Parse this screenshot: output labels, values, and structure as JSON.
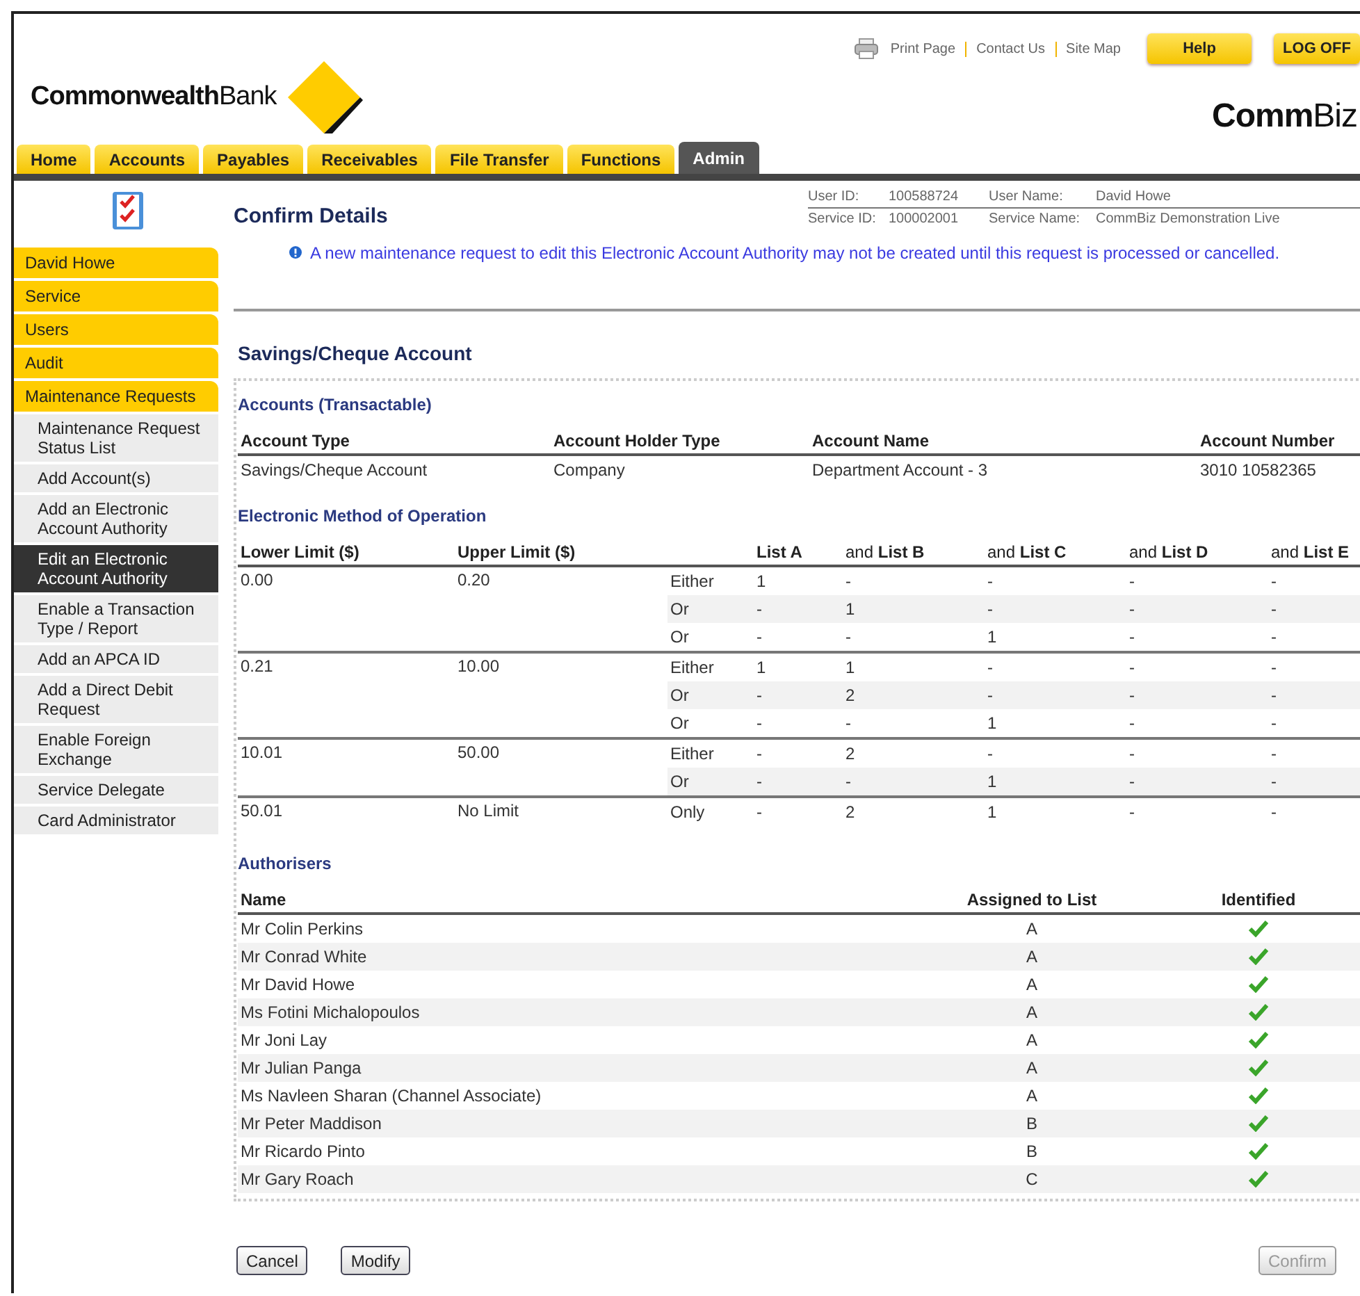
{
  "header": {
    "logo": "**Commonwealth**Bank",
    "links": [
      "Print Page",
      "Contact Us",
      "Site Map"
    ],
    "buttons": [
      "Help",
      "LOG OFF"
    ],
    "brand": "**Comm**Biz"
  },
  "tabs": [
    {
      "label": "Home",
      "selected": false
    },
    {
      "label": "Accounts",
      "selected": false
    },
    {
      "label": "Payables",
      "selected": false
    },
    {
      "label": "Receivables",
      "selected": false
    },
    {
      "label": "File Transfer",
      "selected": false
    },
    {
      "label": "Functions",
      "selected": false
    },
    {
      "label": "Admin",
      "selected": true
    }
  ],
  "sidebar": {
    "items": [
      {
        "label": "David Howe",
        "kind": "section",
        "selected": false
      },
      {
        "label": "Service",
        "kind": "section",
        "selected": false
      },
      {
        "label": "Users",
        "kind": "section",
        "selected": false
      },
      {
        "label": "Audit",
        "kind": "section",
        "selected": false
      },
      {
        "label": "Maintenance Requests",
        "kind": "section",
        "selected": false
      },
      {
        "label": "Maintenance Request Status List",
        "kind": "sub",
        "selected": false
      },
      {
        "label": "Add Account(s)",
        "kind": "sub",
        "selected": false
      },
      {
        "label": "Add an Electronic Account Authority",
        "kind": "sub",
        "selected": false
      },
      {
        "label": "Edit an Electronic Account Authority",
        "kind": "sub",
        "selected": true
      },
      {
        "label": "Enable a Transaction Type / Report",
        "kind": "sub",
        "selected": false
      },
      {
        "label": "Add an APCA ID",
        "kind": "sub",
        "selected": false
      },
      {
        "label": "Add a Direct Debit Request",
        "kind": "sub",
        "selected": false
      },
      {
        "label": "Enable Foreign Exchange",
        "kind": "sub",
        "selected": false
      },
      {
        "label": "Service Delegate",
        "kind": "sub",
        "selected": false
      },
      {
        "label": "Card Administrator",
        "kind": "sub",
        "selected": false
      }
    ]
  },
  "page_title": "Confirm Details",
  "user_info": [
    [
      {
        "label": "User ID:",
        "value": "100588724"
      },
      {
        "label": "User Name:",
        "value": "David Howe"
      }
    ],
    [
      {
        "label": "Service ID:",
        "value": "100002001"
      },
      {
        "label": "Service Name:",
        "value": "CommBiz Demonstration Live"
      }
    ]
  ],
  "notice": "A new maintenance request to edit this Electronic Account Authority may not be created until this request is processed or cancelled.",
  "account_heading": "Savings/Cheque Account",
  "accounts": {
    "title": "Accounts (Transactable)",
    "columns": [
      "Account Type",
      "Account Holder Type",
      "Account Name",
      "Account Number"
    ],
    "rows": [
      [
        "Savings/Cheque Account",
        "Company",
        "Department Account - 3",
        "3010 10582365"
      ]
    ]
  },
  "method": {
    "title": "Electronic Method of Operation",
    "columns": [
      "Lower Limit ($)",
      "Upper Limit ($)",
      "",
      "**List A**",
      "and **List B**",
      "and **List C**",
      "and **List D**",
      "and **List E**"
    ],
    "bands": [
      {
        "lower": "0.00",
        "upper": "0.20",
        "options": [
          [
            "Either",
            "1",
            "-",
            "-",
            "-",
            "-"
          ],
          [
            "Or",
            "-",
            "1",
            "-",
            "-",
            "-"
          ],
          [
            "Or",
            "-",
            "-",
            "1",
            "-",
            "-"
          ]
        ]
      },
      {
        "lower": "0.21",
        "upper": "10.00",
        "options": [
          [
            "Either",
            "1",
            "1",
            "-",
            "-",
            "-"
          ],
          [
            "Or",
            "-",
            "2",
            "-",
            "-",
            "-"
          ],
          [
            "Or",
            "-",
            "-",
            "1",
            "-",
            "-"
          ]
        ]
      },
      {
        "lower": "10.01",
        "upper": "50.00",
        "options": [
          [
            "Either",
            "-",
            "2",
            "-",
            "-",
            "-"
          ],
          [
            "Or",
            "-",
            "-",
            "1",
            "-",
            "-"
          ]
        ]
      },
      {
        "lower": "50.01",
        "upper": "No Limit",
        "options": [
          [
            "Only",
            "-",
            "2",
            "1",
            "-",
            "-"
          ]
        ]
      }
    ]
  },
  "authorisers": {
    "title": "Authorisers",
    "columns": [
      "Name",
      "Assigned to List",
      "Identified"
    ],
    "rows": [
      {
        "name": "Mr Colin Perkins",
        "list": "A",
        "identified": true
      },
      {
        "name": "Mr Conrad White",
        "list": "A",
        "identified": true
      },
      {
        "name": "Mr David Howe",
        "list": "A",
        "identified": true
      },
      {
        "name": "Ms Fotini Michalopoulos",
        "list": "A",
        "identified": true
      },
      {
        "name": "Mr Joni Lay",
        "list": "A",
        "identified": true
      },
      {
        "name": "Mr Julian Panga",
        "list": "A",
        "identified": true
      },
      {
        "name": "Ms Navleen Sharan (Channel Associate)",
        "list": "A",
        "identified": true
      },
      {
        "name": "Mr Peter Maddison",
        "list": "B",
        "identified": true
      },
      {
        "name": "Mr Ricardo Pinto",
        "list": "B",
        "identified": true
      },
      {
        "name": "Mr Gary Roach",
        "list": "C",
        "identified": true
      }
    ]
  },
  "actions": [
    {
      "label": "Cancel",
      "disabled": false
    },
    {
      "label": "Modify",
      "disabled": false
    },
    {
      "label": "Confirm",
      "disabled": true
    }
  ]
}
